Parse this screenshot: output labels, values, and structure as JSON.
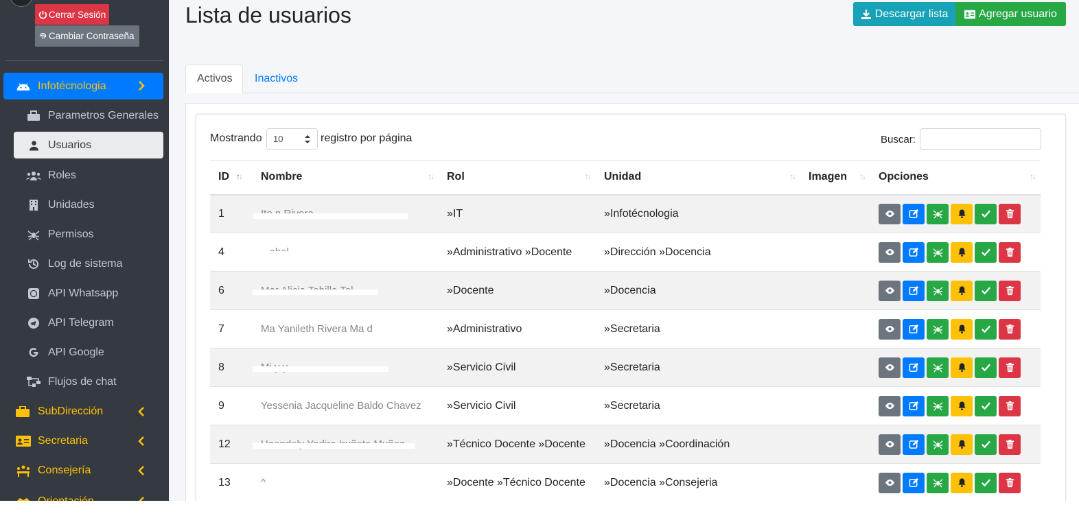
{
  "sidebar": {
    "logout_label": "Cerrar Sesión",
    "change_password_label": "Cambiar Contraseña",
    "main_section": {
      "label": "Infotécnologia",
      "icon": "android-icon"
    },
    "items": [
      {
        "label": "Parametros Generales",
        "icon": "toolbox-icon"
      },
      {
        "label": "Usuarios",
        "icon": "user-icon",
        "active": true
      },
      {
        "label": "Roles",
        "icon": "users-icon"
      },
      {
        "label": "Unidades",
        "icon": "building-icon"
      },
      {
        "label": "Permisos",
        "icon": "spider-icon"
      },
      {
        "label": "Log de sistema",
        "icon": "history-icon"
      },
      {
        "label": "API Whatsapp",
        "icon": "whatsapp-icon"
      },
      {
        "label": "API Telegram",
        "icon": "telegram-icon"
      },
      {
        "label": "API Google",
        "icon": "google-icon"
      },
      {
        "label": "Flujos de chat",
        "icon": "sitemap-icon"
      }
    ],
    "sections": [
      {
        "label": "SubDirección",
        "icon": "briefcase-icon"
      },
      {
        "label": "Secretaria",
        "icon": "id-card-icon"
      },
      {
        "label": "Consejería",
        "icon": "meeting-icon"
      },
      {
        "label": "Orientación",
        "icon": "handshake-icon"
      }
    ]
  },
  "header": {
    "title": "Lista de usuarios",
    "download_label": "Descargar lista",
    "add_label": "Agregar usuario"
  },
  "tabs": [
    {
      "label": "Activos",
      "active": true
    },
    {
      "label": "Inactivos",
      "active": false
    }
  ],
  "table_controls": {
    "showing_label": "Mostrando",
    "page_size": "10",
    "per_page_label": "registro por página",
    "search_label": "Buscar:"
  },
  "table": {
    "columns": [
      "ID",
      "Nombre",
      "Rol",
      "Unidad",
      "Imagen",
      "Opciones"
    ],
    "rows": [
      {
        "id": "1",
        "nombre": "Ito                         n Rivera",
        "rol": "»IT",
        "unidad": "»Infotécnologia"
      },
      {
        "id": "4",
        "nombre": "        ...abel                      ",
        "rol": "»Administrativo »Docente",
        "unidad": "»Dirección »Docencia"
      },
      {
        "id": "6",
        "nombre": "Mar   Alicia Tobillo  Tol   ",
        "rol": "»Docente",
        "unidad": "»Docencia"
      },
      {
        "id": "7",
        "nombre": "Ma      Yanileth Rivera Ma    d",
        "rol": "»Administrativo",
        "unidad": "»Secretaria"
      },
      {
        "id": "8",
        "nombre": "Mi              y      y   ",
        "rol": "»Servicio Civil",
        "unidad": "»Secretaria"
      },
      {
        "id": "9",
        "nombre": "Yessenia Jacqueline Baldo Chavez",
        "rol": "»Servicio Civil",
        "unidad": "»Secretaria"
      },
      {
        "id": "12",
        "nombre": "Haendoly Yadira Iruñeta Muñoz",
        "rol": "»Técnico Docente »Docente",
        "unidad": "»Docencia »Coordinación"
      },
      {
        "id": "13",
        "nombre": "^",
        "rol": "»Docente »Técnico Docente",
        "unidad": "»Docencia »Consejeria"
      }
    ]
  },
  "colors": {
    "sidebar_bg": "#343a40",
    "primary": "#007bff",
    "warning": "#ffc107",
    "success": "#28a745",
    "info": "#17a2b8",
    "danger": "#dc3545",
    "secondary": "#6c757d"
  }
}
